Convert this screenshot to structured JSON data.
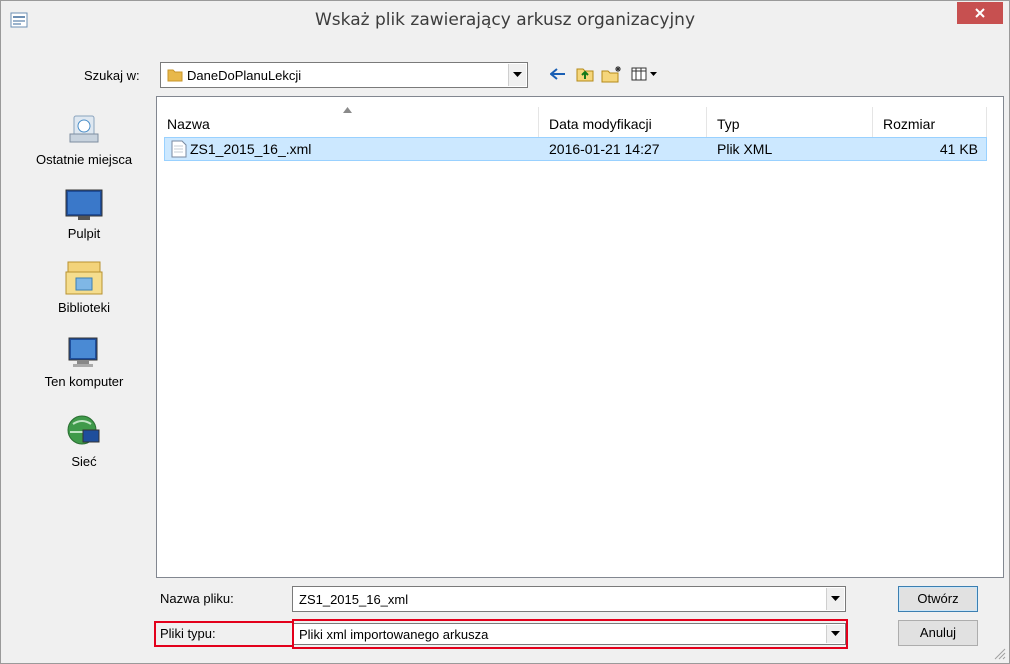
{
  "window": {
    "title": "Wskaż plik zawierający arkusz organizacyjny"
  },
  "lookin": {
    "label": "Szukaj w:",
    "value": "DaneDoPlanuLekcji"
  },
  "toolbar": {
    "icons": [
      "back-arrow-icon",
      "up-folder-icon",
      "new-folder-icon",
      "view-menu-icon"
    ]
  },
  "places": [
    {
      "label": "Ostatnie miejsca",
      "icon": "recent-places-icon"
    },
    {
      "label": "Pulpit",
      "icon": "desktop-icon"
    },
    {
      "label": "Biblioteki",
      "icon": "libraries-icon"
    },
    {
      "label": "Ten komputer",
      "icon": "computer-icon"
    },
    {
      "label": "Sieć",
      "icon": "network-icon"
    }
  ],
  "columns": [
    "Nazwa",
    "Data modyfikacji",
    "Typ",
    "Rozmiar"
  ],
  "files": [
    {
      "name": "ZS1_2015_16_.xml",
      "modified": "2016-01-21 14:27",
      "type": "Plik XML",
      "size": "41 KB"
    }
  ],
  "filename": {
    "label": "Nazwa pliku:",
    "value": "ZS1_2015_16_xml"
  },
  "filetype": {
    "label": "Pliki typu:",
    "value": "Pliki xml importowanego arkusza"
  },
  "buttons": {
    "open": "Otwórz",
    "cancel": "Anuluj"
  },
  "colors": {
    "close_button": "#c75050",
    "selection": "#cce8ff",
    "highlight_box": "#e3001b"
  }
}
